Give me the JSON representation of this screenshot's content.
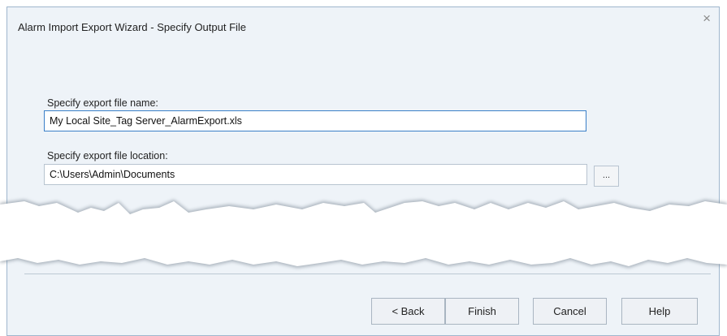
{
  "dialog": {
    "title": "Alarm Import Export Wizard - Specify Output File",
    "close_glyph": "×",
    "close_icon": "close-icon"
  },
  "form": {
    "file_name_label": "Specify export file name:",
    "file_name_value": "My Local Site_Tag Server_AlarmExport.xls",
    "location_label": "Specify export file location:",
    "location_value": "C:\\Users\\Admin\\Documents",
    "browse_label": "..."
  },
  "buttons": {
    "back": "< Back",
    "finish": "Finish",
    "cancel": "Cancel",
    "help": "Help"
  }
}
